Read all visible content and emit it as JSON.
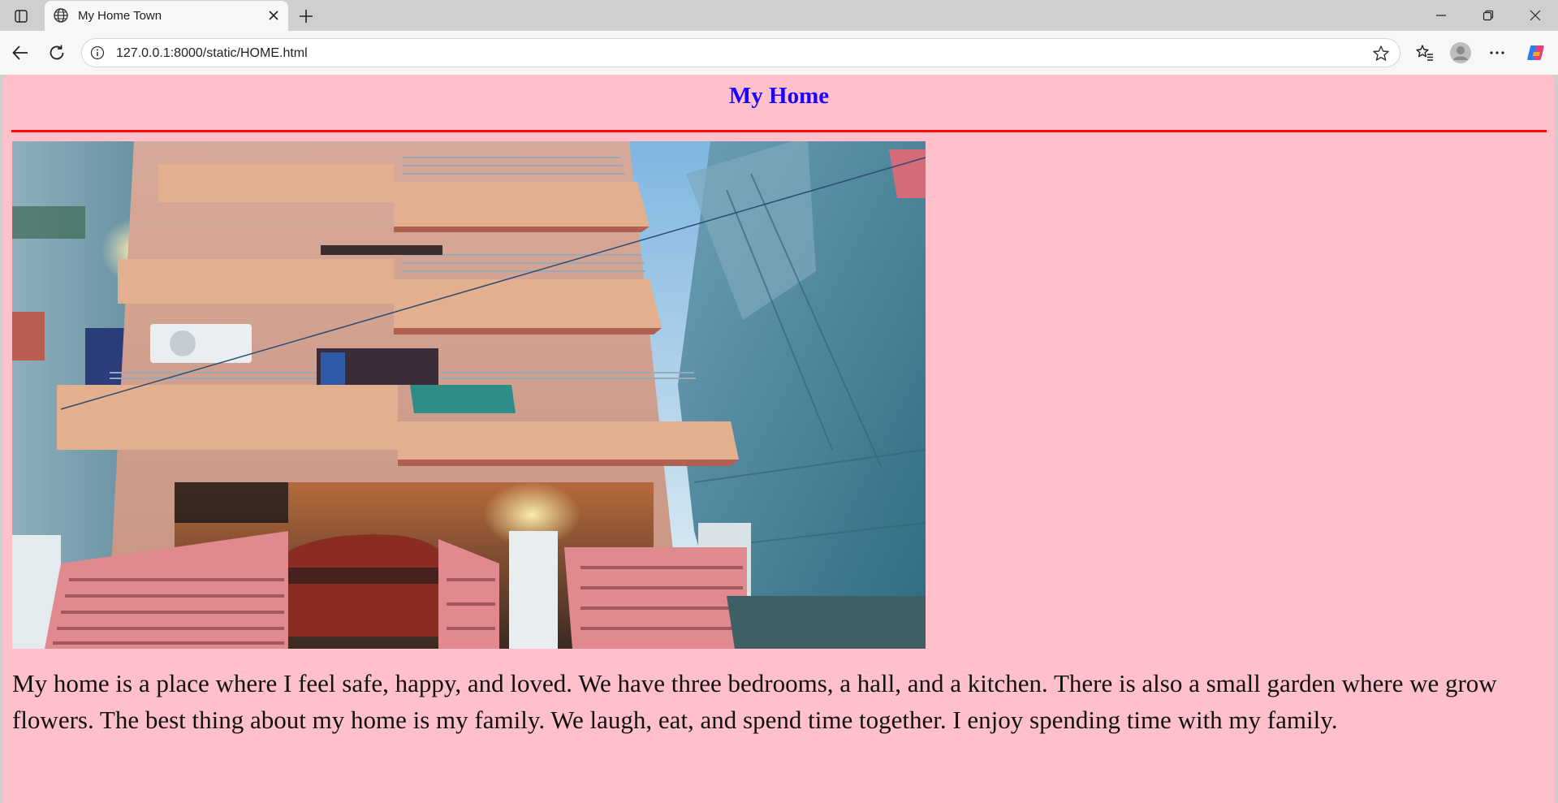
{
  "browser": {
    "tab_title": "My Home Town",
    "url": "127.0.0.1:8000/static/HOME.html",
    "icons": {
      "tab_actions": "tab-actions-icon",
      "favicon": "globe-icon",
      "close": "close-icon",
      "new_tab": "plus-icon",
      "minimize": "minimize-icon",
      "restore": "restore-icon",
      "window_close": "window-close-icon",
      "back": "back-arrow-icon",
      "refresh": "refresh-icon",
      "site_info": "info-icon",
      "favorite": "star-icon",
      "favorites": "favorites-icon",
      "profile": "avatar-icon",
      "more": "more-icon",
      "copilot": "copilot-icon"
    }
  },
  "page": {
    "heading": "My Home",
    "image_alt": "photo of a multi-storey house",
    "paragraph": "My home is a place where I feel safe, happy, and loved. We have three bedrooms, a hall, and a kitchen. There is also a small garden where we grow flowers. The best thing about my home is my family. We laugh, eat, and spend time together. I enjoy spending time with my family.",
    "colors": {
      "background": "#ffc0cb",
      "heading": "#1a00ff",
      "rule": "#ff0a0a"
    }
  }
}
